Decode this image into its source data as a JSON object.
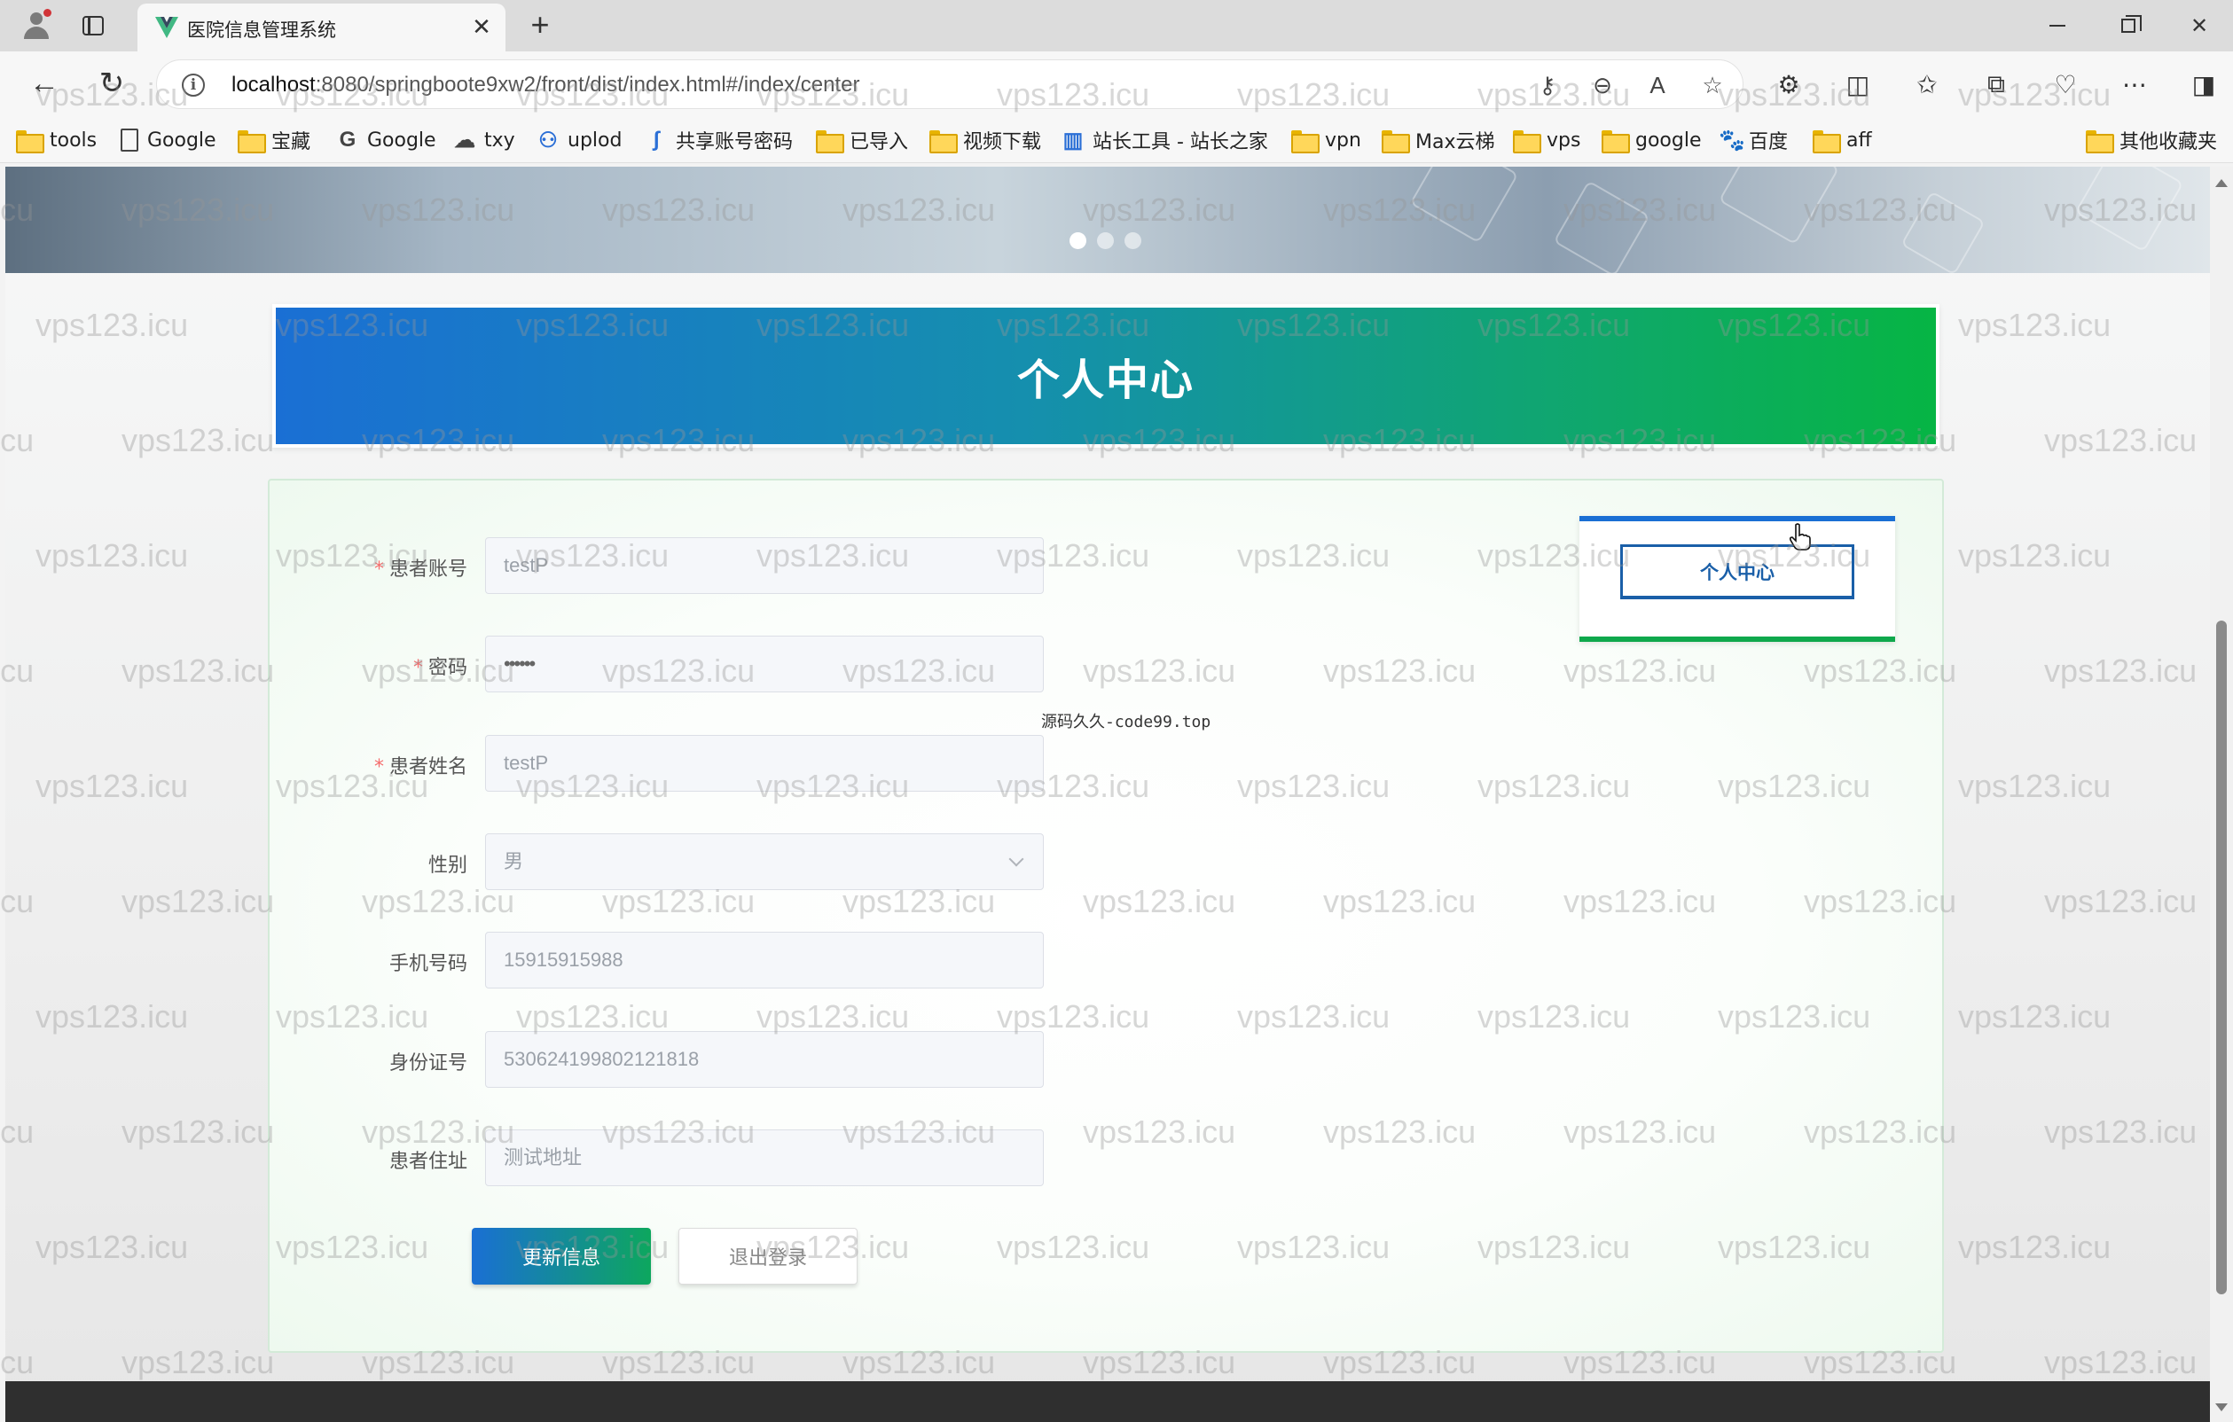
{
  "browser": {
    "tab_title": "医院信息管理系统",
    "url_host": "localhost",
    "url_path": ":8080/springboote9xw2/front/dist/index.html#/index/center",
    "bookmarks": [
      {
        "label": "tools",
        "icon": "folder-icon"
      },
      {
        "label": "Google",
        "icon": "page-icon"
      },
      {
        "label": "宝藏",
        "icon": "folder-icon"
      },
      {
        "label": "Google",
        "icon": "google-icon"
      },
      {
        "label": "txy",
        "icon": "cloud-icon"
      },
      {
        "label": "uplod",
        "icon": "upload-icon"
      },
      {
        "label": "共享账号密码",
        "icon": "share-icon"
      },
      {
        "label": "已导入",
        "icon": "folder-icon"
      },
      {
        "label": "视频下载",
        "icon": "folder-icon"
      },
      {
        "label": "站长工具 - 站长之家",
        "icon": "chart-icon"
      },
      {
        "label": "vpn",
        "icon": "folder-icon"
      },
      {
        "label": "Max云梯",
        "icon": "folder-icon"
      },
      {
        "label": "vps",
        "icon": "folder-icon"
      },
      {
        "label": "google",
        "icon": "folder-icon"
      },
      {
        "label": "百度",
        "icon": "baidu-icon"
      },
      {
        "label": "aff",
        "icon": "folder-icon"
      }
    ],
    "other_bookmarks": "其他收藏夹"
  },
  "page": {
    "title": "个人中心",
    "form": [
      {
        "label": "患者账号",
        "required": true,
        "value": "testP",
        "type": "input"
      },
      {
        "label": "密码",
        "required": true,
        "value": "••••••",
        "type": "password"
      },
      {
        "label": "患者姓名",
        "required": true,
        "value": "testP",
        "type": "input"
      },
      {
        "label": "性别",
        "required": false,
        "value": "男",
        "type": "select"
      },
      {
        "label": "手机号码",
        "required": false,
        "value": "15915915988",
        "type": "input"
      },
      {
        "label": "身份证号",
        "required": false,
        "value": "530624199802121818",
        "type": "input"
      },
      {
        "label": "患者住址",
        "required": false,
        "value": "测试地址",
        "type": "input"
      }
    ],
    "update_button": "更新信息",
    "logout_button": "退出登录",
    "side_menu_item": "个人中心",
    "note": "源码久久-code99.top"
  },
  "watermark_text": "vps123.icu",
  "colors": {
    "header_gradient_start": "#1a6fd4",
    "header_gradient_end": "#06b544",
    "required_mark": "#f56c6c"
  }
}
